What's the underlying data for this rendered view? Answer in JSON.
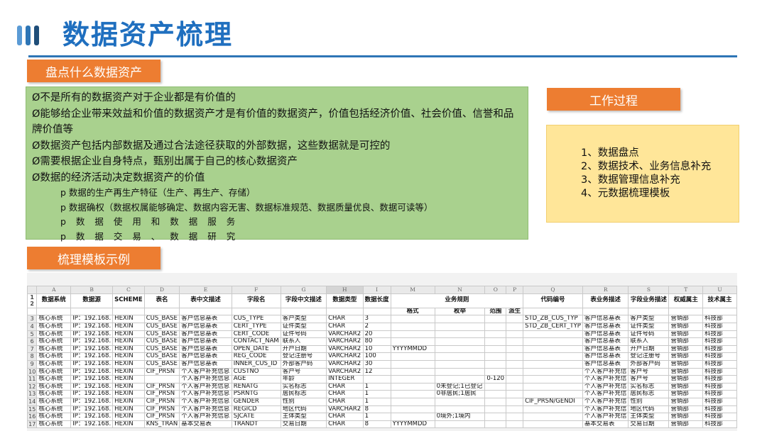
{
  "header": {
    "title": "数据资产梳理"
  },
  "labels": {
    "inventory": "盘点什么数据资产",
    "process": "工作过程",
    "template": "梳理模板示例"
  },
  "inventory_points": [
    "Ø不是所有的数据资产对于企业都是有价值的",
    "Ø能够给企业带来效益和价值的数据资产才是有价值的数据资产，价值包括经济价值、社会价值、信誉和品牌价值等",
    "Ø数据资产包括内部数据及通过合法途径获取的外部数据，这些数据就是可控的",
    "Ø需要根据企业自身特点，甄别出属于自己的核心数据资产",
    "Ø数据的经济活动决定数据资产的价值"
  ],
  "inventory_subpoints": [
    "p 数据的生产再生产特征（生产、再生产、存储）",
    "p 数据确权（数据权属能够确定、数据内容无害、数据标准规范、数据质量优良、数据可读等）",
    "p 数 据 使 用 和 数 据 服 务",
    "p 数 据 交 易 、 数 据 研 究"
  ],
  "process_steps": [
    "1、数据盘点",
    "2、数据技术、业务信息补充",
    "3、数据管理信息补充",
    "4、元数据梳理模板"
  ],
  "sheet": {
    "column_letters": [
      "A",
      "B",
      "C",
      "D",
      "E",
      "F",
      "G",
      "H",
      "I",
      "M",
      "N",
      "O",
      "P",
      "Q",
      "R",
      "S",
      "T",
      "U"
    ],
    "row_numbers": [
      "1",
      "2",
      "3",
      "4",
      "5",
      "6",
      "7",
      "8",
      "9",
      "10",
      "11",
      "12",
      "13",
      "14",
      "15",
      "16",
      "17"
    ],
    "headers": {
      "system": "数据系统",
      "source": "数据源",
      "schema": "SCHEME",
      "table": "表名",
      "table_desc": "表中文描述",
      "field": "字段名",
      "field_desc": "字段中文描述",
      "data_type": "数据类型",
      "data_length": "数据长度",
      "business_rules": "业务规则",
      "format": "格式",
      "enum": "枚举",
      "range": "范围",
      "derived": "派生",
      "code_id": "代码编号",
      "table_business_desc": "表业务描述",
      "field_business_desc": "字段业务描述",
      "authority_owner": "权威属主",
      "tech_owner": "技术属主"
    },
    "rows": [
      [
        "核心系统",
        "IP：192.168.",
        "HEXIN",
        "CUS_BASE",
        "客户信息基表",
        "CUS_TYPE",
        "客户类型",
        "CHAR",
        "3",
        "",
        "",
        "",
        "",
        "STD_ZB_CUS_TYP",
        "客户信息基表",
        "客户类型",
        "营销部",
        "科技部"
      ],
      [
        "核心系统",
        "IP：192.168.",
        "HEXIN",
        "CUS_BASE",
        "客户信息基表",
        "CERT_TYPE",
        "证件类型",
        "CHAR",
        "2",
        "",
        "",
        "",
        "",
        "STD_ZB_CERT_TYP",
        "客户信息基表",
        "证件类型",
        "营销部",
        "科技部"
      ],
      [
        "核心系统",
        "IP：192.168.",
        "HEXIN",
        "CUS_BASE",
        "客户信息基表",
        "CERT_CODE",
        "证件号码",
        "VARCHAR2",
        "20",
        "",
        "",
        "",
        "",
        "",
        "客户信息基表",
        "证件号码",
        "营销部",
        "科技部"
      ],
      [
        "核心系统",
        "IP：192.168.",
        "HEXIN",
        "CUS_BASE",
        "客户信息基表",
        "CONTACT_NAM",
        "联系人",
        "VARCHAR2",
        "80",
        "",
        "",
        "",
        "",
        "",
        "客户信息基表",
        "联系人",
        "营销部",
        "科技部"
      ],
      [
        "核心系统",
        "IP：192.168.",
        "HEXIN",
        "CUS_BASE",
        "客户信息基表",
        "OPEN_DATE",
        "开户日期",
        "VARCHAR2",
        "10",
        "YYYYMMDD",
        "",
        "",
        "",
        "",
        "客户信息基表",
        "开户日期",
        "营销部",
        "科技部"
      ],
      [
        "核心系统",
        "IP：192.168.",
        "HEXIN",
        "CUS_BASE",
        "客户信息基表",
        "REG_CODE",
        "登记注册号",
        "VARCHAR2",
        "100",
        "",
        "",
        "",
        "",
        "",
        "客户信息基表",
        "登记注册号",
        "营销部",
        "科技部"
      ],
      [
        "核心系统",
        "IP：192.168.",
        "HEXIN",
        "CUS_BASE",
        "客户信息基表",
        "INNER_CUS_ID",
        "外部客户码",
        "VARCHAR2",
        "30",
        "",
        "",
        "",
        "",
        "",
        "客户信息基表",
        "外部客户码",
        "营销部",
        "科技部"
      ],
      [
        "核心系统",
        "IP：192.168.",
        "HEXIN",
        "CIF_PRSN",
        "个人客户补充信息",
        "CUSTNO",
        "客户号",
        "VARCHAR2",
        "12",
        "",
        "",
        "",
        "",
        "",
        "个人客户补充信",
        "客户号",
        "营销部",
        "科技部"
      ],
      [
        "核心系统",
        "IP：192.168.",
        "HEXIN",
        "",
        "个人客户补充信息",
        "AGE",
        "年龄",
        "INTEGER",
        "",
        "",
        "",
        "0-120",
        "",
        "",
        "个人客户补充信",
        "客户号",
        "营销部",
        "科技部"
      ],
      [
        "核心系统",
        "IP：192.168.",
        "HEXIN",
        "CIF_PRSN",
        "个人客户补充信息",
        "RENATG",
        "实名标志",
        "CHAR",
        "1",
        "",
        "0未登记;1已登记",
        "",
        "",
        "",
        "个人客户补充信",
        "实名标志",
        "营销部",
        "科技部"
      ],
      [
        "核心系统",
        "IP：192.168.",
        "HEXIN",
        "CIF_PRSN",
        "个人客户补充信息",
        "PSRNTG",
        "居民标志",
        "CHAR",
        "1",
        "",
        "0非居民;1居民",
        "",
        "",
        "",
        "个人客户补充信",
        "居民标志",
        "营销部",
        "科技部"
      ],
      [
        "核心系统",
        "IP：192.168.",
        "HEXIN",
        "CIF_PRSN",
        "个人客户补充信息",
        "GENDER",
        "性别",
        "CHAR",
        "1",
        "",
        "",
        "",
        "",
        "CIF_PRSN/GENDI",
        "个人客户补充信",
        "性别",
        "营销部",
        "科技部"
      ],
      [
        "核心系统",
        "IP：192.168.",
        "HEXIN",
        "CIF_PRSN",
        "个人客户补充信息",
        "REGICD",
        "地区代码",
        "VARCHAR2",
        "8",
        "",
        "",
        "",
        "",
        "",
        "个人客户补充信",
        "地区代码",
        "营销部",
        "科技部"
      ],
      [
        "核心系统",
        "IP：192.168.",
        "HEXIN",
        "CIF_PRSN",
        "个人客户补充信息",
        "SJCATE",
        "主体类型",
        "CHAR",
        "1",
        "",
        "0境外;1境内",
        "",
        "",
        "",
        "个人客户补充信",
        "主体类型",
        "营销部",
        "科技部"
      ],
      [
        "核心系统",
        "IP：192.168.",
        "HEXIN",
        "KNS_TRAN",
        "基本交易表",
        "TRANDT",
        "交易日期",
        "CHAR",
        "8",
        "YYYYMMDD",
        "",
        "",
        "",
        "",
        "基本交易表",
        "交易日期",
        "营销部",
        "科技部"
      ]
    ]
  },
  "colors": {
    "title": "#1f6fbf",
    "rule": "#2e75b6",
    "orange": "#ed7d31",
    "green_box": "#a9d18e",
    "yellow_box": "#ffe699"
  }
}
